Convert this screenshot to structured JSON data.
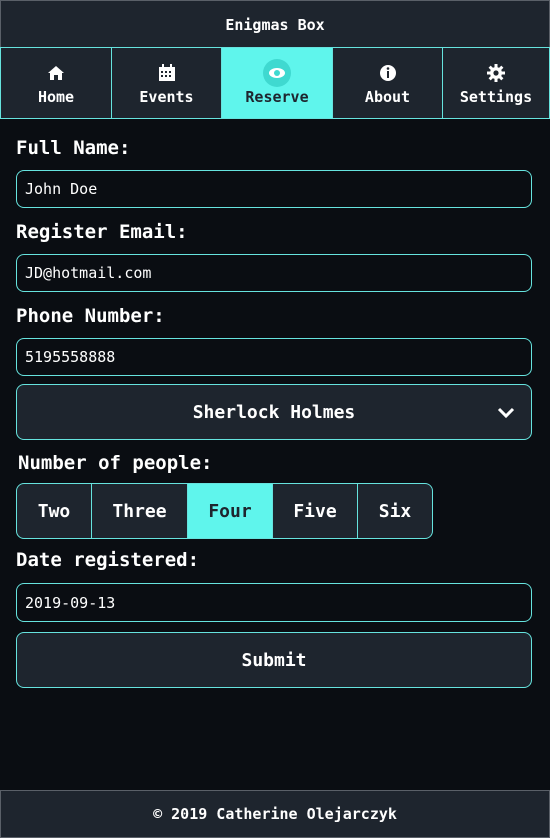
{
  "app": {
    "title": "Enigmas Box"
  },
  "colors": {
    "accent": "#5ff5ec",
    "panel": "#1e252e",
    "background": "#0a0d12",
    "border": "#66e3de"
  },
  "nav": {
    "tabs": [
      {
        "label": "Home",
        "icon": "home-icon"
      },
      {
        "label": "Events",
        "icon": "calendar-icon"
      },
      {
        "label": "Reserve",
        "icon": "eye-icon",
        "active": true
      },
      {
        "label": "About",
        "icon": "info-icon"
      },
      {
        "label": "Settings",
        "icon": "gear-icon"
      }
    ]
  },
  "form": {
    "full_name": {
      "label": "Full Name:",
      "value": "John Doe"
    },
    "email": {
      "label": "Register Email:",
      "value": "JD@hotmail.com"
    },
    "phone": {
      "label": "Phone Number:",
      "value": "5195558888"
    },
    "room": {
      "selected": "Sherlock Holmes"
    },
    "people": {
      "label": "Number of people:",
      "options": [
        "Two",
        "Three",
        "Four",
        "Five",
        "Six"
      ],
      "selected": "Four"
    },
    "date": {
      "label": "Date registered:",
      "value": "2019-09-13"
    },
    "submit_label": "Submit"
  },
  "footer": {
    "text": "© 2019 Catherine Olejarczyk"
  }
}
